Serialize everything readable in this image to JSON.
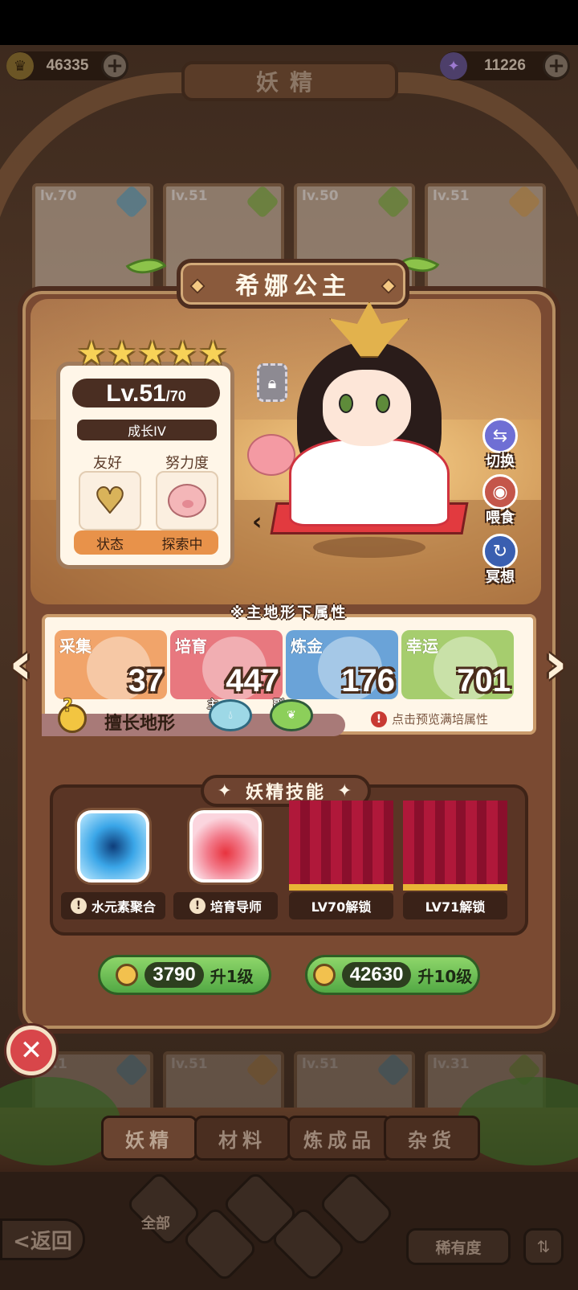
{
  "screen_title": "妖精",
  "currency": {
    "gold": "46335",
    "gems": "11226",
    "add_symbol": "+"
  },
  "background_shelf": {
    "top_levels": [
      "lv.70",
      "lv.51",
      "lv.50",
      "lv.51"
    ],
    "bottom_levels": [
      "lv.1",
      "lv.51",
      "lv.51",
      "lv.31"
    ]
  },
  "fairy": {
    "name": "希娜公主",
    "stars": 5,
    "star_glyph": "★",
    "level": "Lv.51",
    "level_max": "/70",
    "growth": "成长IV",
    "friendship_label": "友好",
    "effort_label": "努力度",
    "status_label": "状态",
    "status_value": "探索中"
  },
  "side_actions": {
    "switch": "切换",
    "feed": "喂食",
    "meditate": "冥想"
  },
  "attributes": {
    "title": "※主地形下属性",
    "items": [
      {
        "label": "采集",
        "value": "37",
        "color": "#f1a46a"
      },
      {
        "label": "培育",
        "value": "447",
        "color": "#e8787f"
      },
      {
        "label": "炼金",
        "value": "176",
        "color": "#6aa3d8"
      },
      {
        "label": "幸运",
        "value": "701",
        "color": "#a6cd6e"
      }
    ],
    "terrain_label": "擅长地形",
    "main_tag": "主",
    "sub_tag": "副",
    "preview_hint": "点击预览满培属性",
    "warn_symbol": "!"
  },
  "skills": {
    "title": "妖精技能",
    "items": [
      {
        "label": "水元素聚合",
        "locked": false,
        "icon": "water-swirl-icon"
      },
      {
        "label": "培育导师",
        "locked": false,
        "icon": "tomato-growth-icon"
      },
      {
        "label": "LV70解锁",
        "locked": true
      },
      {
        "label": "LV71解锁",
        "locked": true
      }
    ]
  },
  "upgrade": {
    "one": {
      "cost": "3790",
      "label": "升1级"
    },
    "ten": {
      "cost": "42630",
      "label": "升10级"
    }
  },
  "tabs": [
    "妖精",
    "材料",
    "炼成品",
    "杂货"
  ],
  "bottom": {
    "back": "<返回",
    "filter_all": "全部",
    "rarity": "稀有度"
  },
  "colors": {
    "accent_green": "#52a844",
    "close_red": "#d8464a",
    "panel_brown": "#7a4a32"
  }
}
